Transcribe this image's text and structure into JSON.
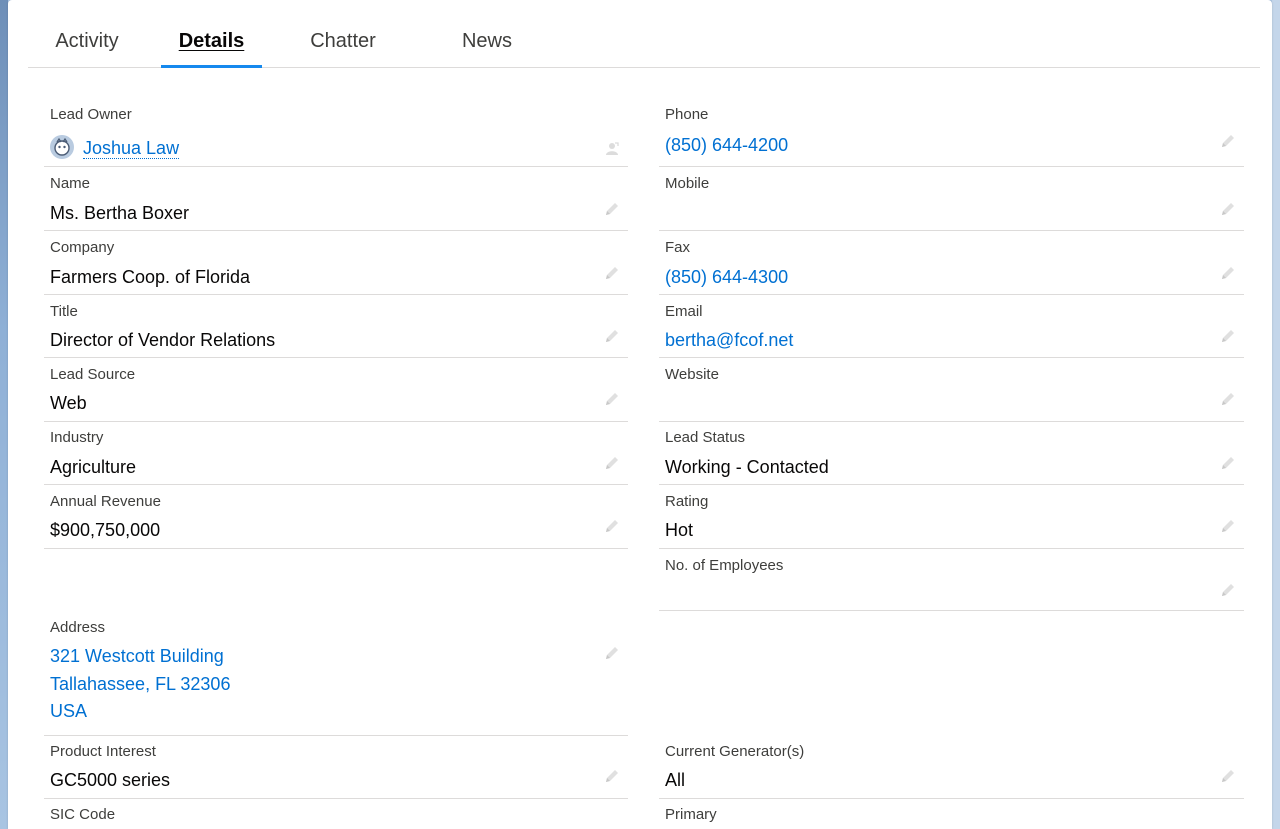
{
  "tabs": [
    "Activity",
    "Details",
    "Chatter",
    "News"
  ],
  "active_tab": "Details",
  "left_fields": {
    "lead_owner": {
      "label": "Lead Owner",
      "value": "Joshua Law"
    },
    "name": {
      "label": "Name",
      "value": "Ms. Bertha Boxer"
    },
    "company": {
      "label": "Company",
      "value": "Farmers Coop. of Florida"
    },
    "title": {
      "label": "Title",
      "value": "Director of Vendor Relations"
    },
    "lead_source": {
      "label": "Lead Source",
      "value": "Web"
    },
    "industry": {
      "label": "Industry",
      "value": "Agriculture"
    },
    "annual_revenue": {
      "label": "Annual Revenue",
      "value": "$900,750,000"
    },
    "address": {
      "label": "Address",
      "line1": "321 Westcott Building",
      "line2": "Tallahassee, FL 32306",
      "line3": "USA"
    },
    "product_interest": {
      "label": "Product Interest",
      "value": "GC5000 series"
    },
    "sic_code": {
      "label": "SIC Code",
      "value": ""
    }
  },
  "right_fields": {
    "phone": {
      "label": "Phone",
      "value": "(850) 644-4200"
    },
    "mobile": {
      "label": "Mobile",
      "value": ""
    },
    "fax": {
      "label": "Fax",
      "value": "(850) 644-4300"
    },
    "email": {
      "label": "Email",
      "value": "bertha@fcof.net"
    },
    "website": {
      "label": "Website",
      "value": ""
    },
    "lead_status": {
      "label": "Lead Status",
      "value": "Working - Contacted"
    },
    "rating": {
      "label": "Rating",
      "value": "Hot"
    },
    "employees": {
      "label": "No. of Employees",
      "value": ""
    },
    "current_generators": {
      "label": "Current Generator(s)",
      "value": "All"
    },
    "primary": {
      "label": "Primary",
      "value": ""
    }
  },
  "icons": {
    "edit": "pencil-icon",
    "change_owner": "change-owner-icon",
    "avatar": "user-avatar"
  },
  "colors": {
    "link": "#0070d2",
    "tab_active_bar": "#1589ee",
    "divider": "#dddbda"
  }
}
